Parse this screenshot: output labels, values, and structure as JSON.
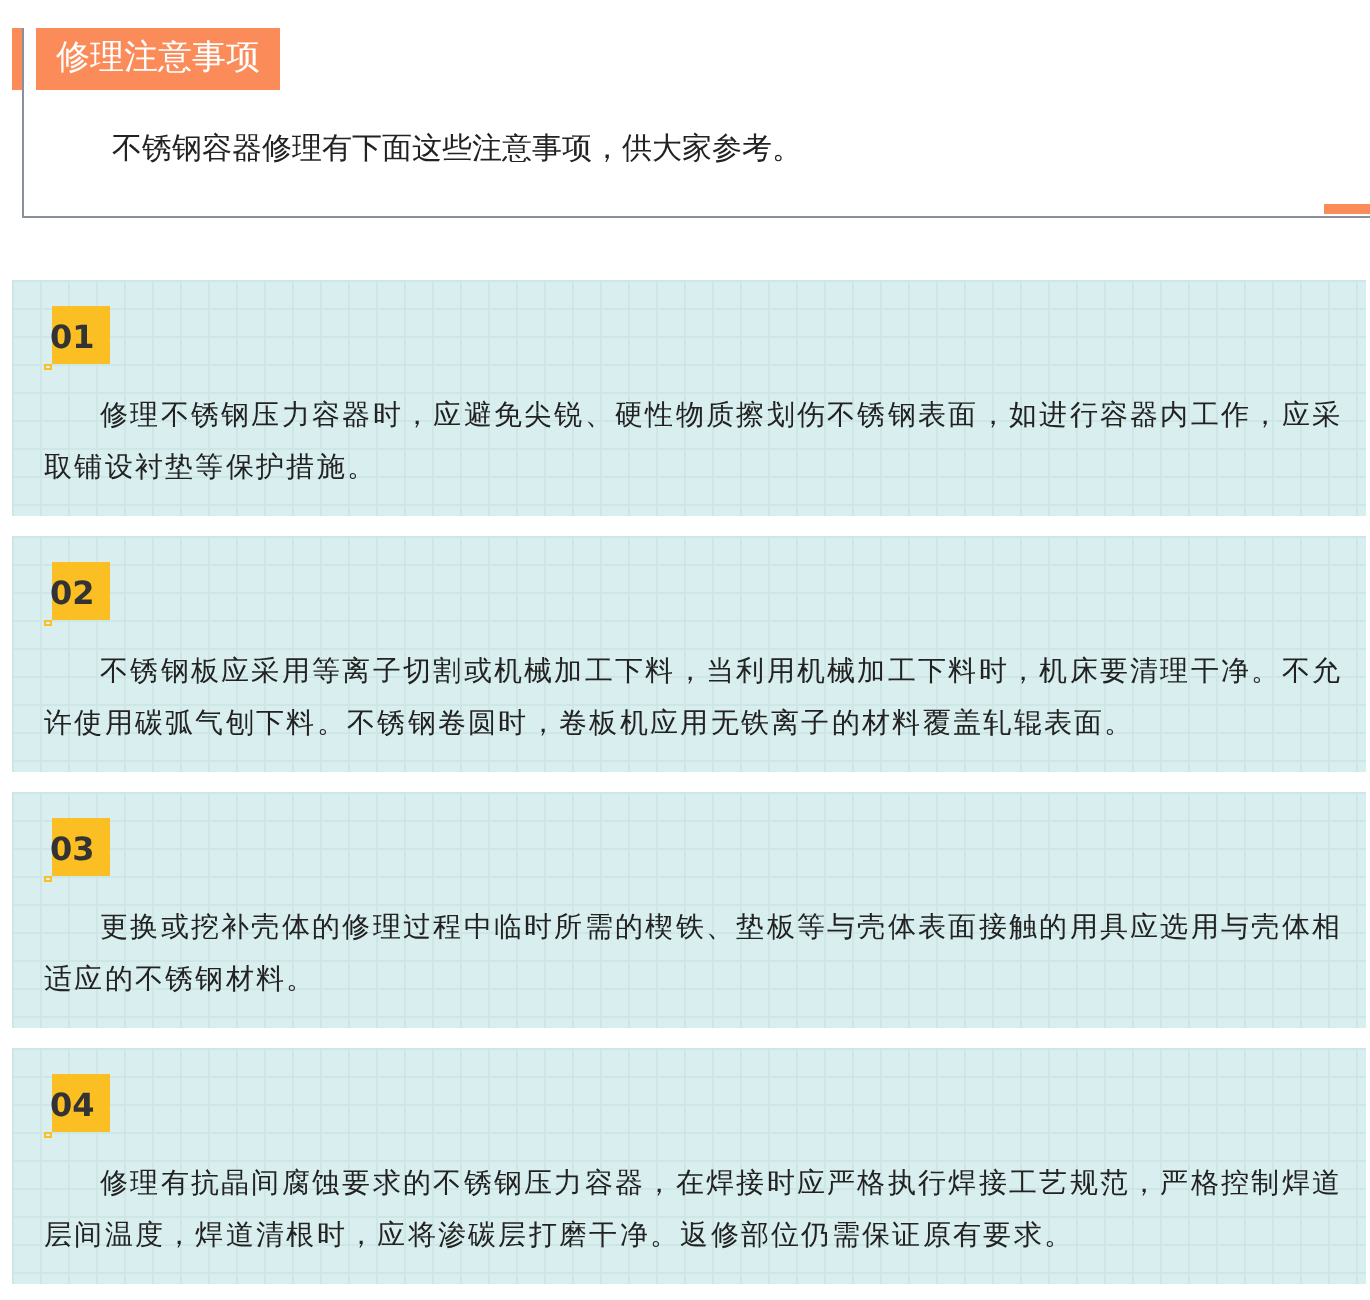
{
  "header": {
    "title": "修理注意事项",
    "intro": "不锈钢容器修理有下面这些注意事项，供大家参考。"
  },
  "items": [
    {
      "number": "01",
      "text": "修理不锈钢压力容器时，应避免尖锐、硬性物质擦划伤不锈钢表面，如进行容器内工作，应采取铺设衬垫等保护措施。"
    },
    {
      "number": "02",
      "text": "不锈钢板应采用等离子切割或机械加工下料，当利用机械加工下料时，机床要清理干净。不允许使用碳弧气刨下料。不锈钢卷圆时，卷板机应用无铁离子的材料覆盖轧辊表面。"
    },
    {
      "number": "03",
      "text": "更换或挖补壳体的修理过程中临时所需的楔铁、垫板等与壳体表面接触的用具应选用与壳体相适应的不锈钢材料。"
    },
    {
      "number": "04",
      "text": "修理有抗晶间腐蚀要求的不锈钢压力容器，在焊接时应严格执行焊接工艺规范，严格控制焊道层间温度，焊道清根时，应将渗碳层打磨干净。返修部位仍需保证原有要求。"
    }
  ]
}
